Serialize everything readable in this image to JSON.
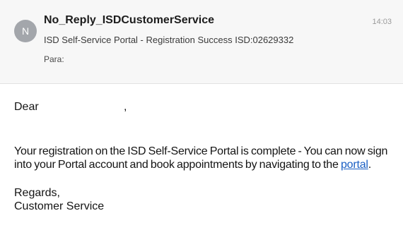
{
  "header": {
    "avatar_initial": "N",
    "sender": "No_Reply_ISDCustomerService",
    "subject": "ISD Self-Service Portal - Registration Success ISD:02629332",
    "to_label": "Para:",
    "time": "14:03"
  },
  "body": {
    "greeting": "Dear",
    "greeting_comma": ",",
    "paragraph_before_link": "Your registration on the ISD Self-Service Portal is complete - You can now sign into your Portal account and book appointments by navigating to the ",
    "link_text": "portal",
    "paragraph_after_link": ".",
    "closing": "Regards,",
    "signature": "Customer Service"
  },
  "colors": {
    "link": "#1a5fc4",
    "avatar_bg": "#a3a6ab",
    "header_bg": "#f7f7f7"
  }
}
